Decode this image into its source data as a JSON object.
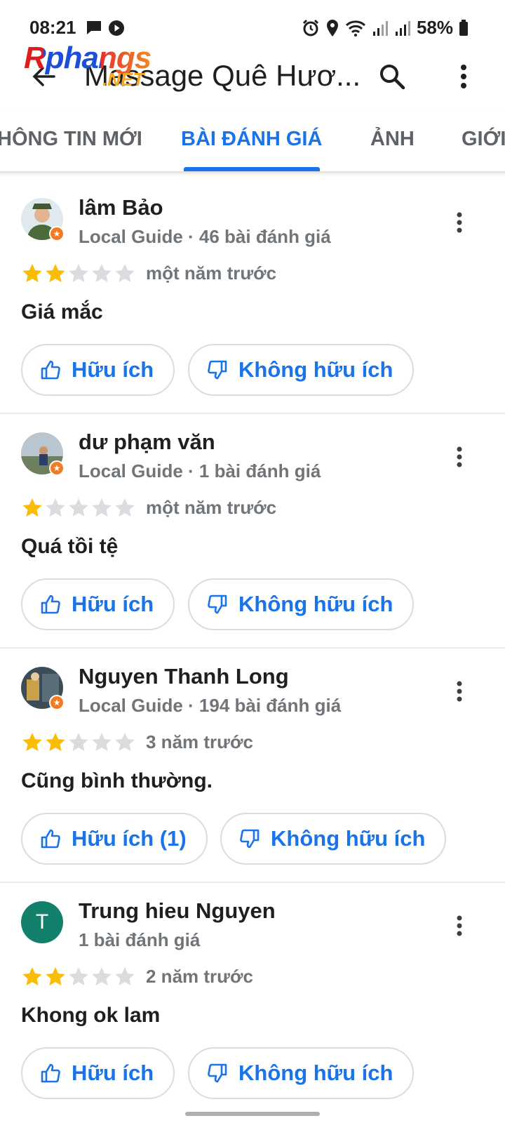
{
  "status_bar": {
    "time": "08:21",
    "battery_percent": "58%"
  },
  "app_bar": {
    "title": "Massage Quê Hươ..."
  },
  "watermark": {
    "brand": "Rphangs",
    "suffix": ".NET"
  },
  "tabs": [
    {
      "label": "HÔNG TIN MỚI"
    },
    {
      "label": "BÀI ĐÁNH GIÁ",
      "active": true
    },
    {
      "label": "ẢNH"
    },
    {
      "label": "GIỚI"
    }
  ],
  "reviews": [
    {
      "name": "lâm Bảo",
      "meta": "Local Guide · 46 bài đánh giá",
      "rating": 2,
      "time": "một năm trước",
      "text": "Giá mắc",
      "helpful_label": "Hữu ích",
      "not_helpful_label": "Không hữu ích",
      "avatar_type": "photo"
    },
    {
      "name": "dư phạm văn",
      "meta": "Local Guide · 1 bài đánh giá",
      "rating": 1,
      "time": "một năm trước",
      "text": "Quá tồi tệ",
      "helpful_label": "Hữu ích",
      "not_helpful_label": "Không hữu ích",
      "avatar_type": "photo"
    },
    {
      "name": "Nguyen Thanh Long",
      "meta": "Local Guide · 194 bài đánh giá",
      "rating": 2,
      "time": "3 năm trước",
      "text": "Cũng bình thường.",
      "helpful_label": "Hữu ích (1)",
      "not_helpful_label": "Không hữu ích",
      "avatar_type": "photo"
    },
    {
      "name": "Trung hieu Nguyen",
      "meta": "1 bài đánh giá",
      "rating": 2,
      "time": "2 năm trước",
      "text": "Khong ok lam",
      "helpful_label": "Hữu ích",
      "not_helpful_label": "Không hữu ích",
      "avatar_type": "letter",
      "avatar_letter": "T"
    }
  ],
  "colors": {
    "accent": "#1a73e8",
    "star_filled": "#fbbc04",
    "star_empty": "#dadce0",
    "guide_badge": "#f27b21",
    "letter_avatar": "#12806a"
  }
}
